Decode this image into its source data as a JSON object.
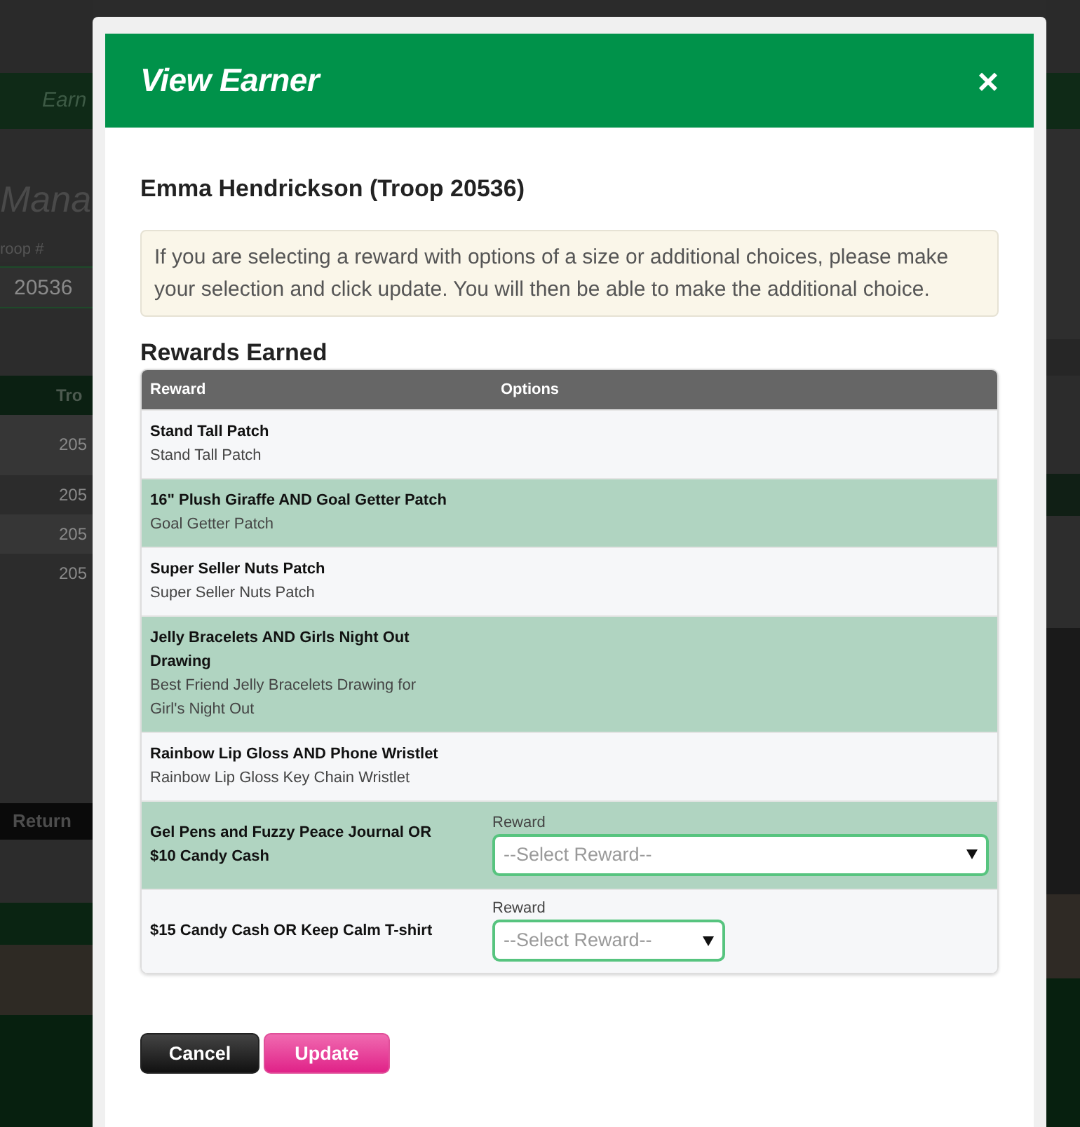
{
  "backdrop": {
    "nav_item": "Earn",
    "page_title": "Mana",
    "field_label": "roop #",
    "field_value": "20536",
    "table_header": "Tro",
    "table_cells": [
      "205",
      "205",
      "205",
      "205"
    ],
    "button": "Return"
  },
  "dialog": {
    "title": "View Earner",
    "close": "×"
  },
  "earner_heading": "Emma Hendrickson (Troop 20536)",
  "notice": "If you are selecting a reward with options of a size or additional choices, please make your selection and click update. You will then be able to make the additional choice.",
  "section_title": "Rewards Earned",
  "table": {
    "columns": [
      "Reward",
      "Options"
    ],
    "rows": [
      {
        "reward": "Stand Tall Patch",
        "detail": "Stand Tall Patch"
      },
      {
        "reward": "16\" Plush Giraffe AND Goal Getter Patch",
        "detail": "Goal Getter Patch"
      },
      {
        "reward": "Super Seller Nuts Patch",
        "detail": "Super Seller Nuts Patch"
      },
      {
        "reward": "Jelly Bracelets AND Girls Night Out Drawing",
        "detail": "Best Friend Jelly Bracelets Drawing for Girl's Night Out"
      },
      {
        "reward": "Rainbow Lip Gloss AND Phone Wristlet",
        "detail": "Rainbow Lip Gloss Key Chain Wristlet"
      },
      {
        "reward": "Gel Pens and Fuzzy Peace Journal OR $10 Candy Cash",
        "option": {
          "label": "Reward",
          "placeholder": "--Select Reward--"
        }
      },
      {
        "reward": "$15 Candy Cash OR Keep Calm T-shirt",
        "option": {
          "label": "Reward",
          "placeholder": "--Select Reward--"
        }
      }
    ]
  },
  "buttons": [
    {
      "label": "Cancel",
      "kind": "secondary"
    },
    {
      "label": "Update",
      "kind": "primary"
    }
  ]
}
